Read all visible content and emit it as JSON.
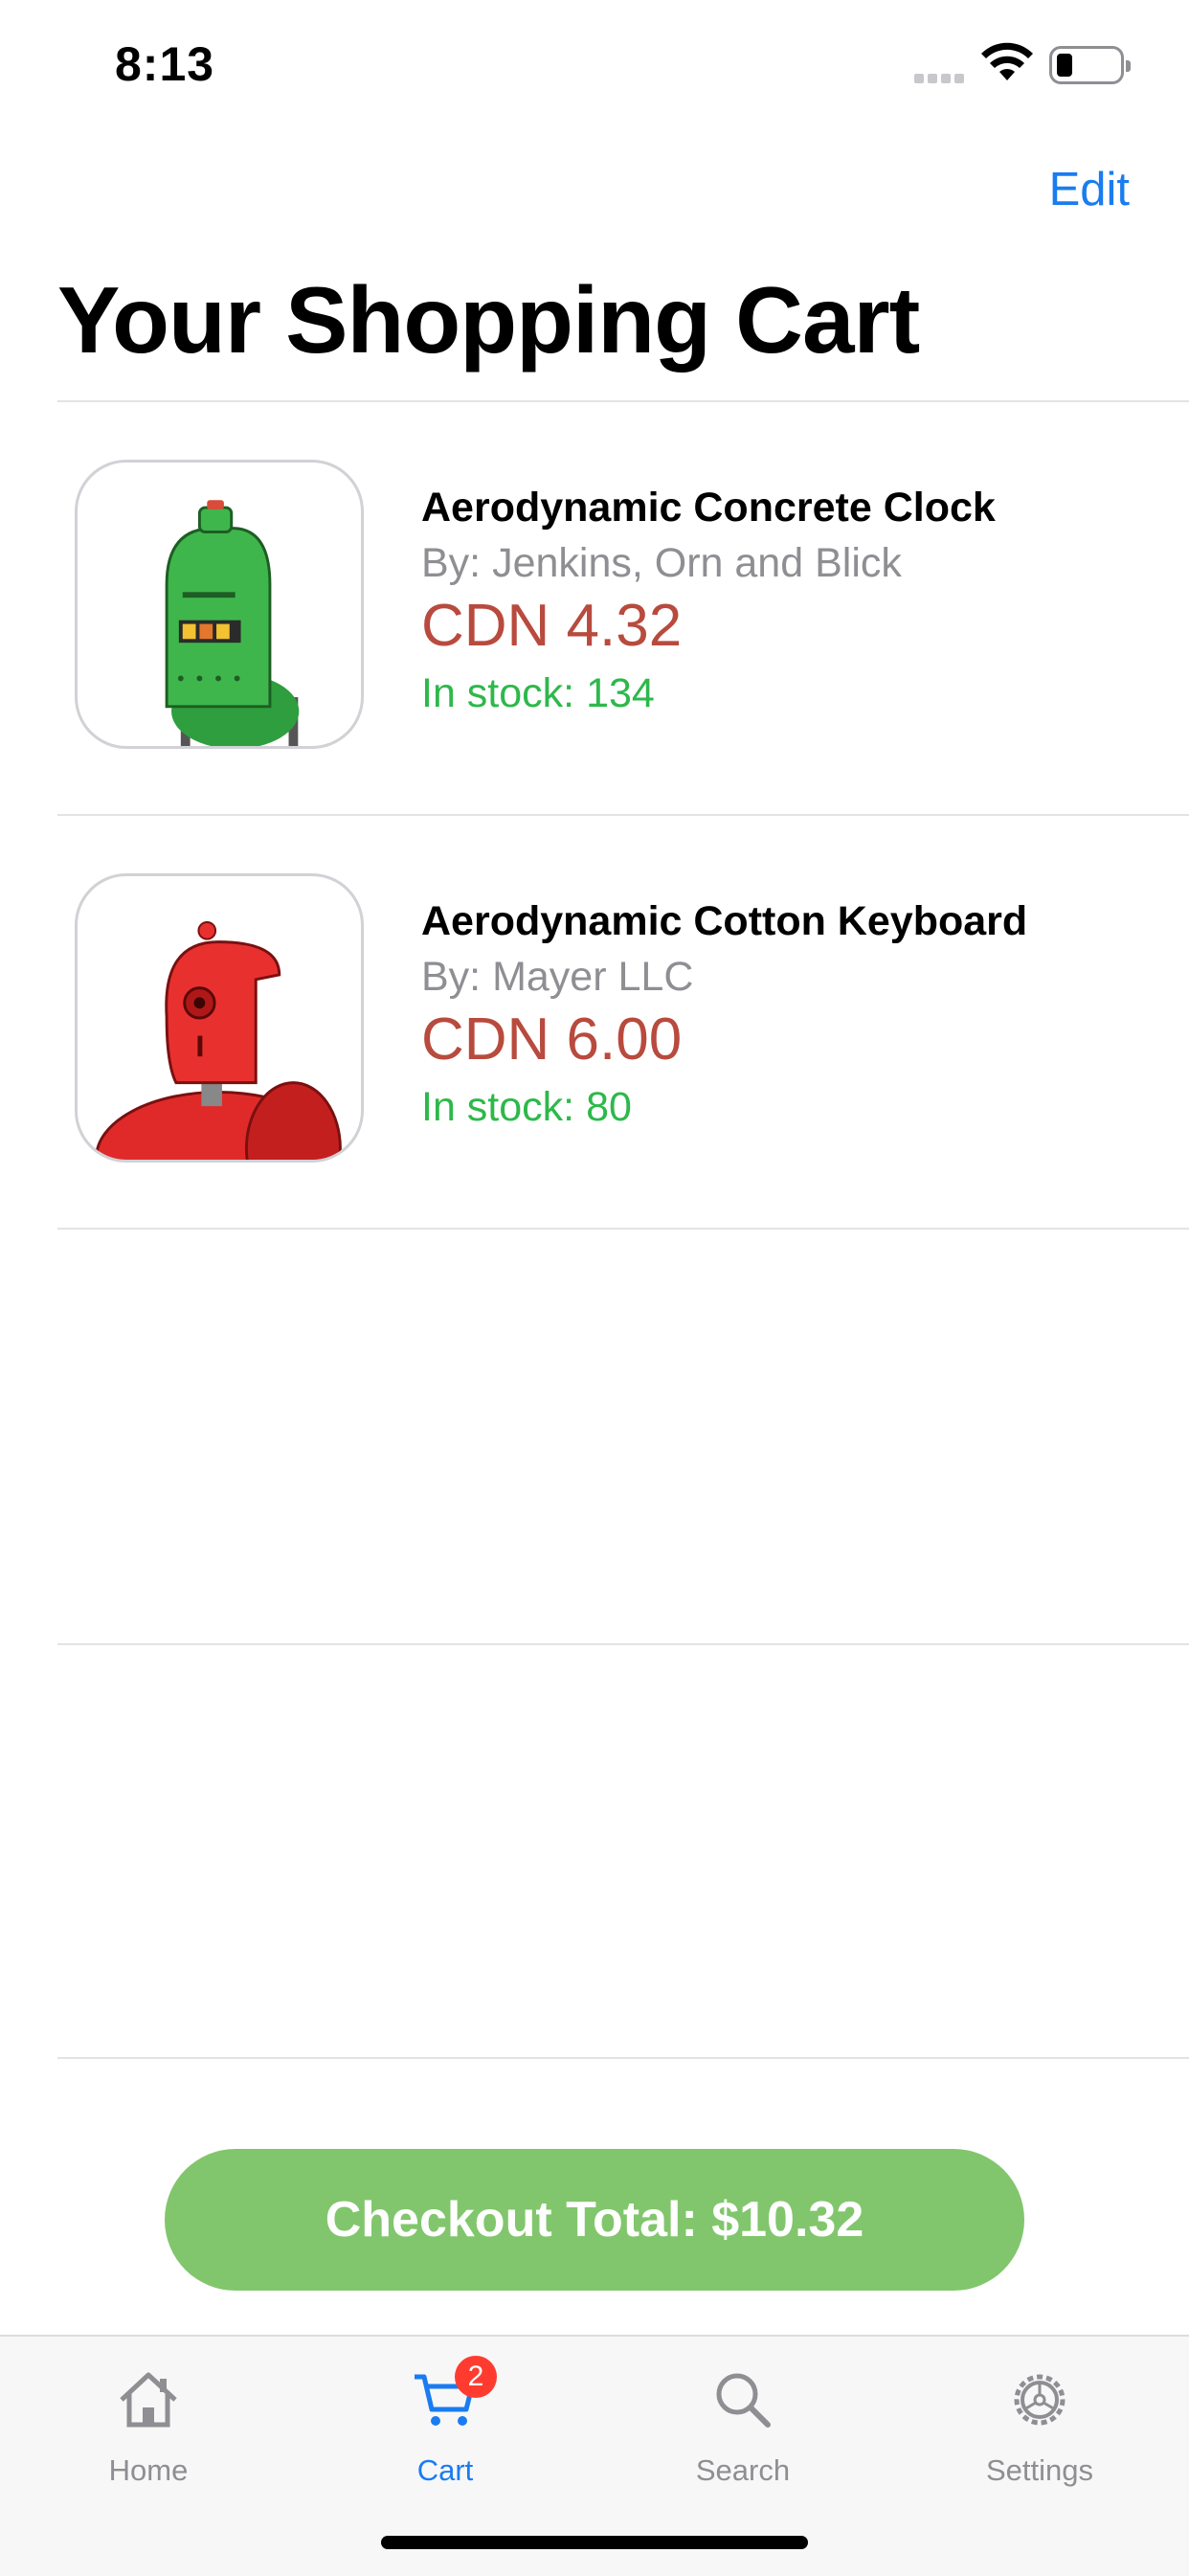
{
  "status_bar": {
    "time": "8:13"
  },
  "nav": {
    "edit_label": "Edit",
    "title": "Your Shopping Cart"
  },
  "items": [
    {
      "name": "Aerodynamic Concrete Clock",
      "brand": "By: Jenkins, Orn and Blick",
      "price": "CDN 4.32",
      "stock": "In stock: 134",
      "image": "green-robot"
    },
    {
      "name": "Aerodynamic Cotton Keyboard",
      "brand": "By: Mayer LLC",
      "price": "CDN 6.00",
      "stock": "In stock: 80",
      "image": "red-robot"
    }
  ],
  "checkout": {
    "label": "Checkout Total: $10.32"
  },
  "tabs": [
    {
      "label": "Home",
      "icon": "house-icon",
      "active": false
    },
    {
      "label": "Cart",
      "icon": "cart-icon",
      "active": true,
      "badge": "2"
    },
    {
      "label": "Search",
      "icon": "magnifier-icon",
      "active": false
    },
    {
      "label": "Settings",
      "icon": "gear-icon",
      "active": false
    }
  ],
  "colors": {
    "accent": "#1a7cf0",
    "price": "#b84a3e",
    "stock": "#2eb84b",
    "checkout": "#81c66c",
    "badge": "#ff3b30"
  }
}
